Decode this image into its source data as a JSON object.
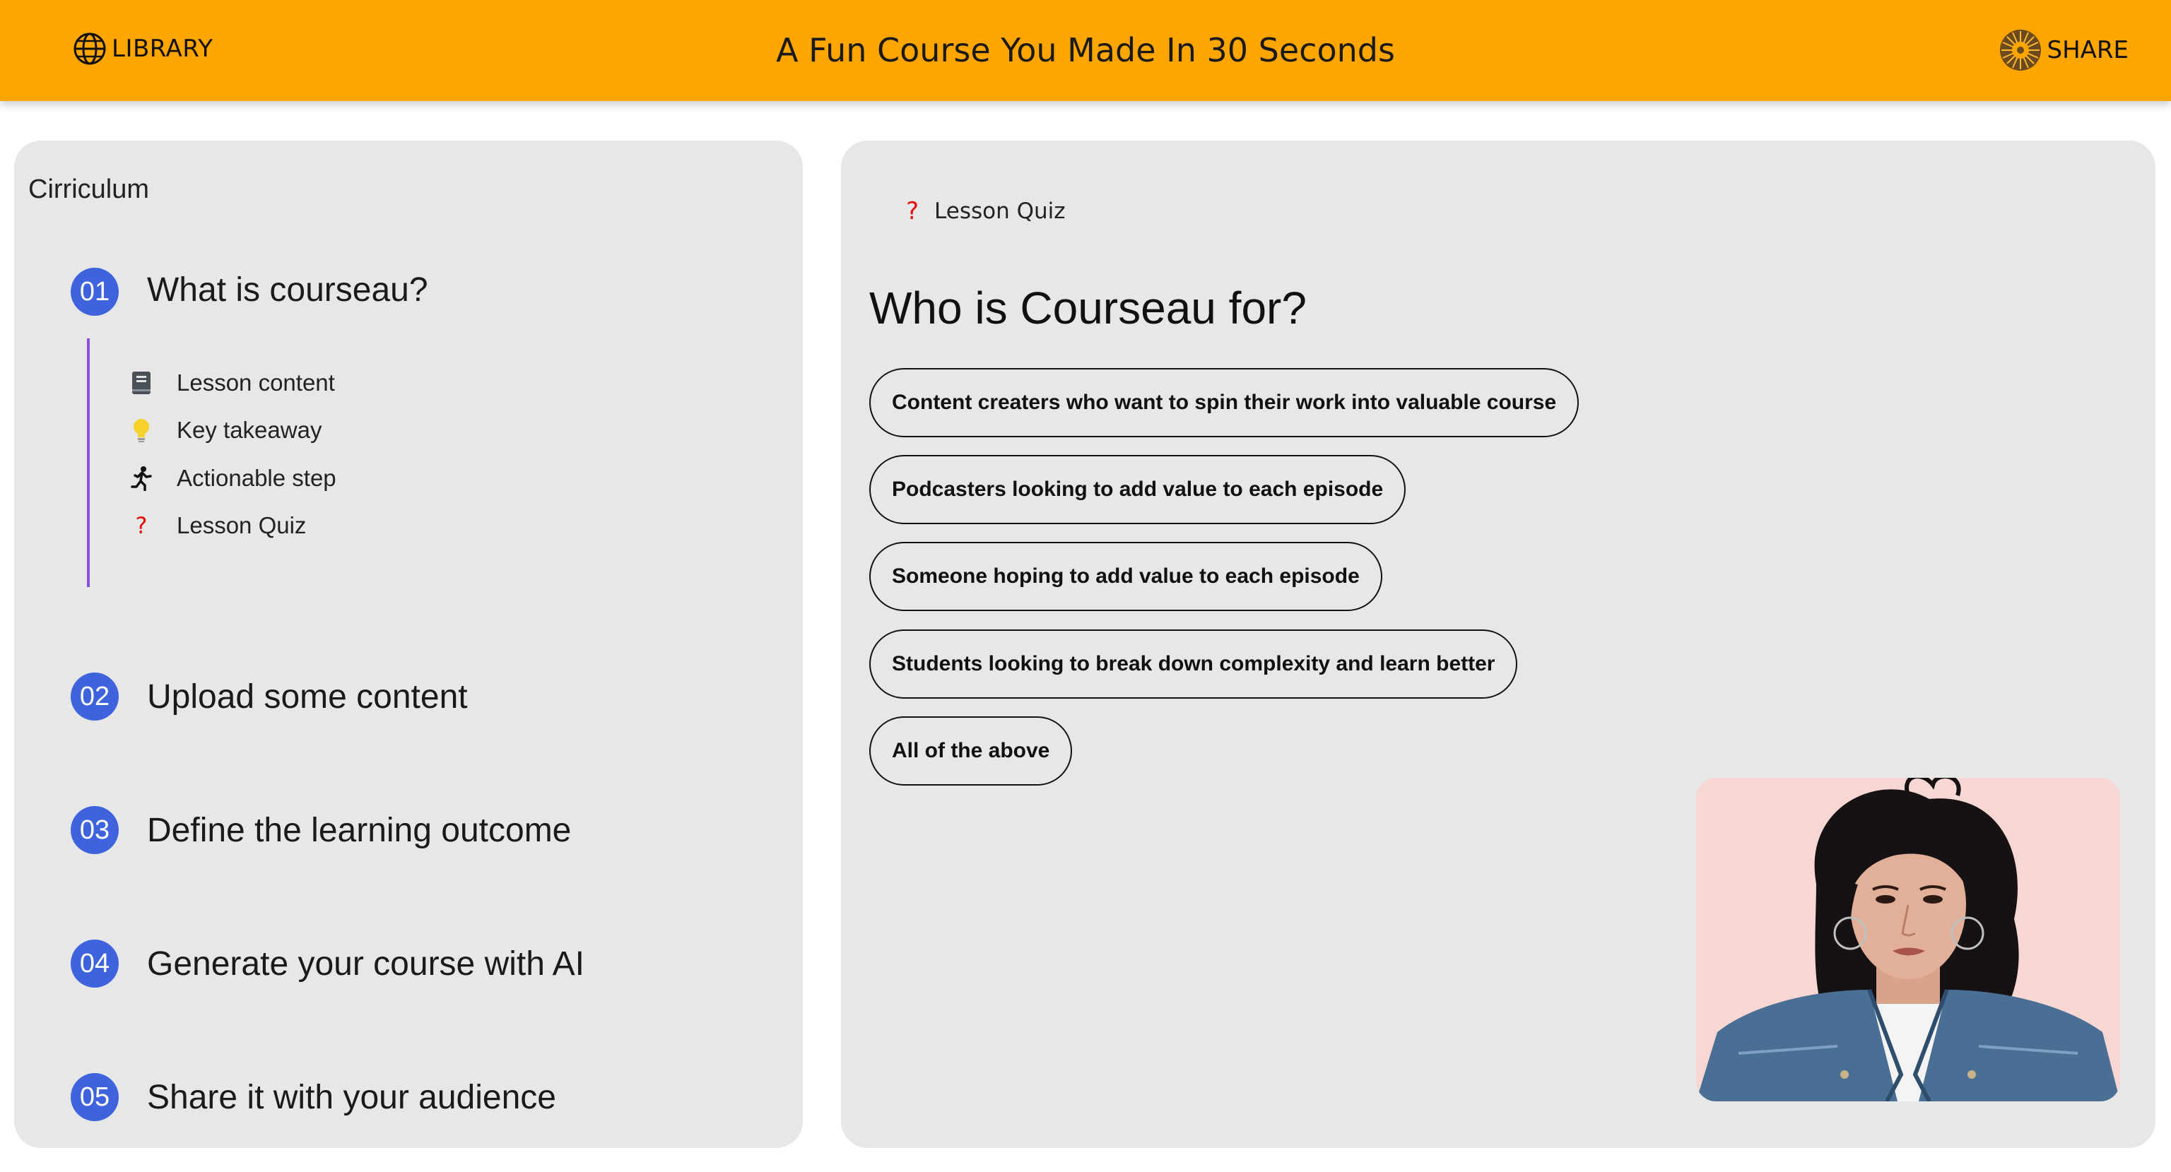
{
  "header": {
    "library_label": "LIBRARY",
    "title": "A Fun Course You Made In 30 Seconds",
    "share_label": "SHARE"
  },
  "curriculum": {
    "heading": "Cirriculum",
    "lessons": [
      {
        "number": "01",
        "title": "What is courseau?"
      },
      {
        "number": "02",
        "title": "Upload some content"
      },
      {
        "number": "03",
        "title": "Define the learning outcome"
      },
      {
        "number": "04",
        "title": "Generate your course with AI"
      },
      {
        "number": "05",
        "title": "Share it with your audience"
      }
    ],
    "sub_items": [
      {
        "icon": "book-icon",
        "label": "Lesson content"
      },
      {
        "icon": "lightbulb-icon",
        "label": "Key takeaway"
      },
      {
        "icon": "running-person-icon",
        "label": "Actionable step"
      },
      {
        "icon": "question-mark-icon",
        "label": "Lesson Quiz"
      }
    ]
  },
  "quiz": {
    "breadcrumb_icon": "?",
    "breadcrumb_label": "Lesson Quiz",
    "question": "Who is Courseau for?",
    "options": [
      "Content creaters who want to spin their work into valuable course",
      "Podcasters looking to add value to each episode",
      "Someone hoping to add value to each episode",
      "Students looking to break down complexity and learn better",
      "All of the above"
    ]
  },
  "colors": {
    "header_bg": "#ffa500",
    "panel_bg": "#e7e7e7",
    "lesson_number_bg": "#3e63dd",
    "timeline": "#8a4fe0",
    "quiz_icon": "#e01010"
  }
}
